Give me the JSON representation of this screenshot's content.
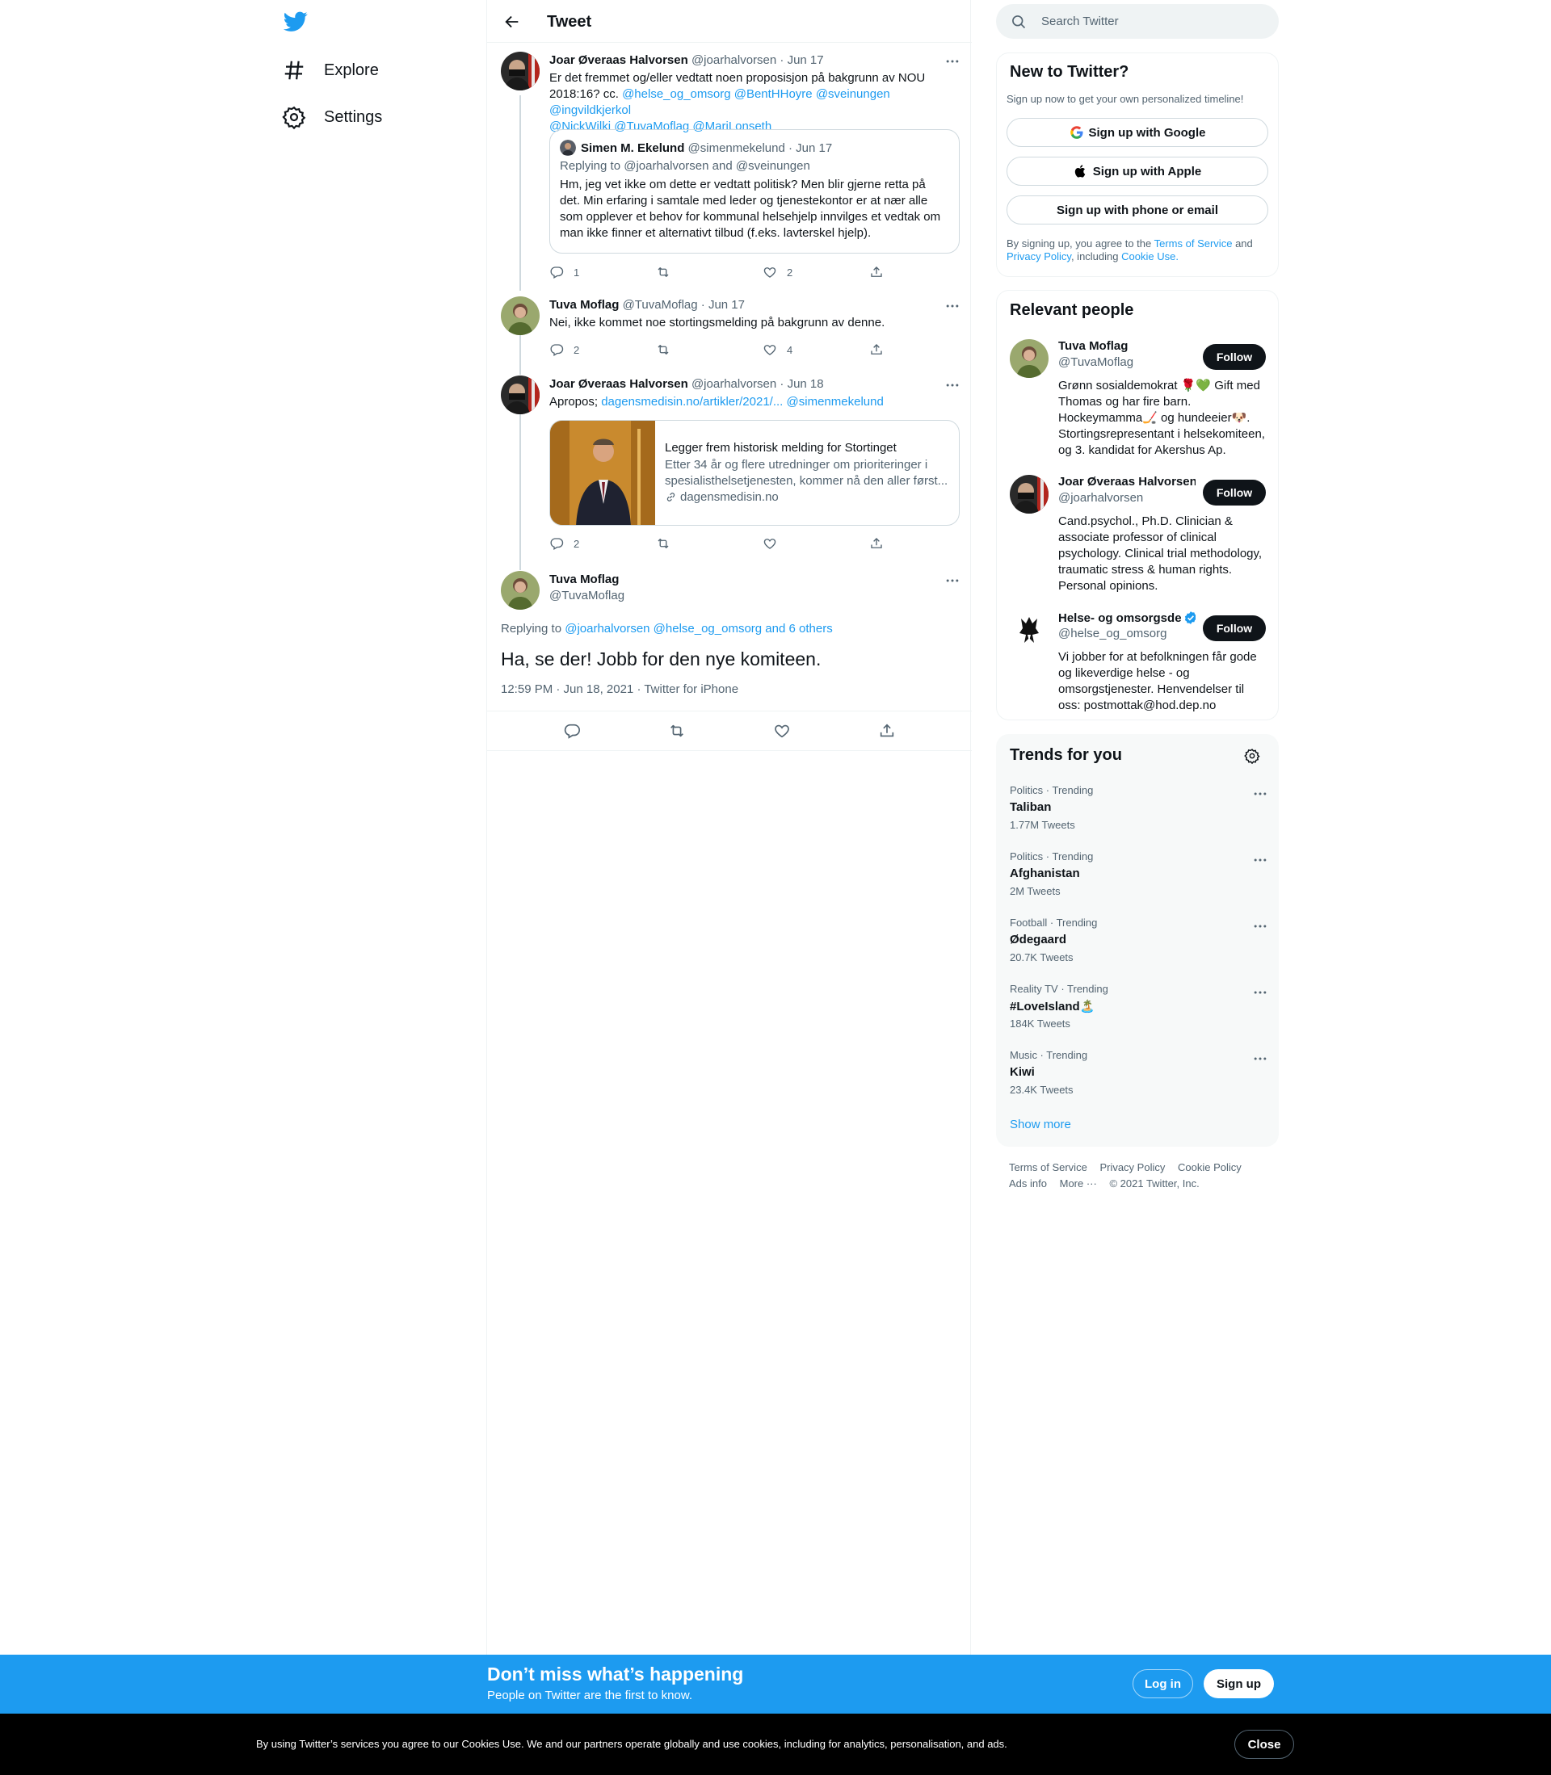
{
  "nav": {
    "explore": "Explore",
    "settings": "Settings"
  },
  "header": {
    "title": "Tweet"
  },
  "tweets": [
    {
      "name": "Joar Øveraas Halvorsen",
      "handle": "@joarhalvorsen",
      "date": "· Jun 17",
      "text_lines": [
        "Er det fremmet og/eller vedtatt noen proposisjon på bakgrunn av NOU",
        "2018:16? cc."
      ],
      "mentions_line2": "@helse_og_omsorg @BentHHoyre @sveinungen @ingvildkjerkol",
      "mentions_line3": "@NickWilki @TuvaMoflag @MariLonseth",
      "quote": {
        "name": "Simen M. Ekelund",
        "handle": "@simenmekelund",
        "date": "· Jun 17",
        "replying": "Replying to @joarhalvorsen and @sveinungen",
        "lines": [
          "Hm, jeg vet ikke om dette er vedtatt politisk? Men blir gjerne retta på",
          "det. Min erfaring i samtale med leder og tjenestekontor er at nær alle",
          "som opplever et behov for kommunal helsehjelp innvilges et vedtak om",
          "man ikke finner et alternativt tilbud (f.eks. lavterskel hjelp)."
        ]
      },
      "replies": "1",
      "retweets": "",
      "likes": "2"
    },
    {
      "name": "Tuva Moflag",
      "handle": "@TuvaMoflag",
      "date": "· Jun 17",
      "text": "Nei, ikke kommet noe stortingsmelding på bakgrunn av denne.",
      "replies": "2",
      "retweets": "",
      "likes": "4"
    },
    {
      "name": "Joar Øveraas Halvorsen",
      "handle": "@joarhalvorsen",
      "date": "· Jun 18",
      "text": "Apropos;",
      "link": "dagensmedisin.no/artikler/2021/...",
      "mention": "@simenmekelund",
      "card": {
        "title": "Legger frem historisk melding for Stortinget",
        "desc1": "Etter 34 år og flere utredninger om prioriteringer i",
        "desc2": "spesialisthelsetjenesten, kommer nå den aller først...",
        "domain": "dagensmedisin.no"
      },
      "replies": "2",
      "retweets": "",
      "likes": ""
    }
  ],
  "main_tweet": {
    "name": "Tuva Moflag",
    "handle": "@TuvaMoflag",
    "replying_label": "Replying to",
    "replying_to": "@joarhalvorsen @helse_og_omsorg and 6 others",
    "text": "Ha, se der! Jobb for den nye komiteen.",
    "meta": "12:59 PM · Jun 18, 2021 · Twitter for iPhone"
  },
  "search": {
    "placeholder": "Search Twitter"
  },
  "signup_panel": {
    "title": "New to Twitter?",
    "subtitle": "Sign up now to get your own personalized timeline!",
    "google": "Sign up with Google",
    "apple": "Sign up with Apple",
    "phone": "Sign up with phone or email",
    "terms_pre": "By signing up, you agree to the",
    "terms_link": "Terms of Service",
    "and": "and",
    "privacy_link": "Privacy Policy",
    "including": ", including",
    "cookie_link": "Cookie Use."
  },
  "relevant": {
    "title": "Relevant people",
    "follow_label": "Follow",
    "people": [
      {
        "name": "Tuva Moflag",
        "handle": "@TuvaMoflag",
        "bio": [
          "Grønn sosialdemokrat 🌹💚 Gift med",
          "Thomas og har fire barn.",
          "Hockeymamma🏒 og hundeeier🐶.",
          "Stortingsrepresentant i helsekomiteen,",
          "og 3. kandidat for Akershus Ap."
        ]
      },
      {
        "name": "Joar Øveraas Halvorsen",
        "handle": "@joarhalvorsen",
        "bio": [
          "Cand.psychol., Ph.D. Clinician &",
          "associate professor of clinical",
          "psychology. Clinical trial methodology,",
          "traumatic stress & human rights.",
          "Personal opinions."
        ]
      },
      {
        "name": "Helse- og omsorgsde",
        "handle": "@helse_og_omsorg",
        "bio": [
          "Vi jobber for at befolkningen får gode",
          "og likeverdige helse - og",
          "omsorgstjenester. Henvendelser til",
          "oss: postmottak@hod.dep.no"
        ]
      }
    ]
  },
  "trends": {
    "title": "Trends for you",
    "items": [
      {
        "category": "Politics · Trending",
        "name": "Taliban",
        "count": "1.77M Tweets"
      },
      {
        "category": "Politics · Trending",
        "name": "Afghanistan",
        "count": "2M Tweets"
      },
      {
        "category": "Football · Trending",
        "name": "Ødegaard",
        "count": "20.7K Tweets"
      },
      {
        "category": "Reality TV · Trending",
        "name": "#LoveIsland🏝️",
        "count": "184K Tweets"
      },
      {
        "category": "Music · Trending",
        "name": "Kiwi",
        "count": "23.4K Tweets"
      }
    ],
    "show_more": "Show more"
  },
  "footer": {
    "terms": "Terms of Service",
    "privacy": "Privacy Policy",
    "cookie": "Cookie Policy",
    "ads": "Ads info",
    "more": "More ···",
    "copyright": "© 2021 Twitter, Inc."
  },
  "bottom_bar": {
    "title": "Don’t miss what’s happening",
    "subtitle": "People on Twitter are the first to know.",
    "login": "Log in",
    "signup": "Sign up"
  },
  "cookie_bar": {
    "text": "By using Twitter’s services you agree to our Cookies Use. We and our partners operate globally and use cookies, including for analytics, personalisation, and ads.",
    "close": "Close"
  },
  "colors": {
    "accent": "#1d9bf0",
    "text": "#0f1419",
    "secondary": "#536471"
  },
  "icons": [
    "twitter-logo-icon",
    "hashtag-icon",
    "gear-icon",
    "back-arrow-icon",
    "more-dots-icon",
    "reply-icon",
    "retweet-icon",
    "like-icon",
    "share-icon",
    "search-icon",
    "google-icon",
    "apple-icon",
    "link-icon",
    "verified-icon"
  ]
}
